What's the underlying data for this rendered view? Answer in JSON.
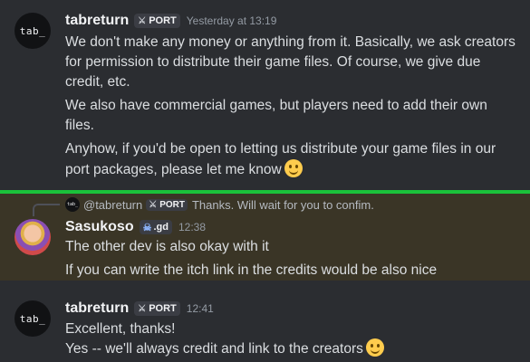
{
  "messages": [
    {
      "avatar_text": "tab_",
      "username": "tabreturn",
      "tag": "PORT",
      "tag_icon": "sword-icon",
      "time": "Yesterday at 13:19",
      "lines": [
        "We don't make any money or anything from it. Basically, we ask creators",
        "for permission to distribute their game files. Of course, we give due",
        "credit, etc.",
        "We also have commercial games, but players need to add their own",
        "files.",
        "Anyhow, if you'd be open to letting us distribute your game files in our",
        "port packages, please let me know"
      ]
    },
    {
      "reply": {
        "avatar_text": "tab_",
        "name": "@tabreturn",
        "tag": "PORT",
        "text": "Thanks. Will wait for you to confim."
      },
      "username": "Sasukoso",
      "tag": ".gd",
      "tag_icon": "skull-icon",
      "time": "12:38",
      "lines": [
        "The other dev is also okay with it",
        "If you can write the itch link in the credits would be also nice"
      ]
    },
    {
      "avatar_text": "tab_",
      "username": "tabreturn",
      "tag": "PORT",
      "tag_icon": "sword-icon",
      "time": "12:41",
      "lines": [
        "Excellent, thanks!",
        "Yes -- we'll always credit and link to the creators"
      ]
    }
  ],
  "colors": {
    "background": "#2b2d31",
    "highlight": "#3a3526",
    "divider": "#1ac13a",
    "text": "#dbdee1",
    "muted": "#949ba4"
  }
}
